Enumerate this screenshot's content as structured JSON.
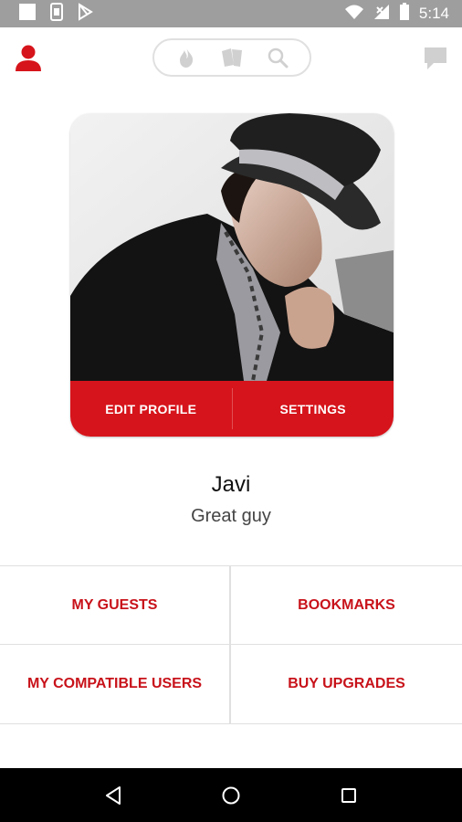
{
  "status_bar": {
    "time": "5:14",
    "icons": [
      "square-icon",
      "sim-icon",
      "play-store-icon",
      "wifi-icon",
      "signal-icon",
      "battery-icon"
    ]
  },
  "app_bar": {
    "icons": [
      "person-icon",
      "flame-icon",
      "cards-icon",
      "search-icon",
      "chat-icon"
    ],
    "accent_color": "#d6141b",
    "inactive_color": "#d0d0d0"
  },
  "profile_card": {
    "edit_label": "EDIT PROFILE",
    "settings_label": "SETTINGS",
    "button_color": "#d6141b"
  },
  "profile": {
    "name": "Javi",
    "tagline": "Great guy"
  },
  "menu": {
    "items": [
      {
        "label": "MY GUESTS"
      },
      {
        "label": "BOOKMARKS"
      },
      {
        "label": "MY COMPATIBLE USERS"
      },
      {
        "label": "BUY UPGRADES"
      }
    ],
    "text_color": "#c8121a"
  },
  "nav_bar": {
    "icons": [
      "back-icon",
      "home-icon",
      "recents-icon"
    ]
  }
}
